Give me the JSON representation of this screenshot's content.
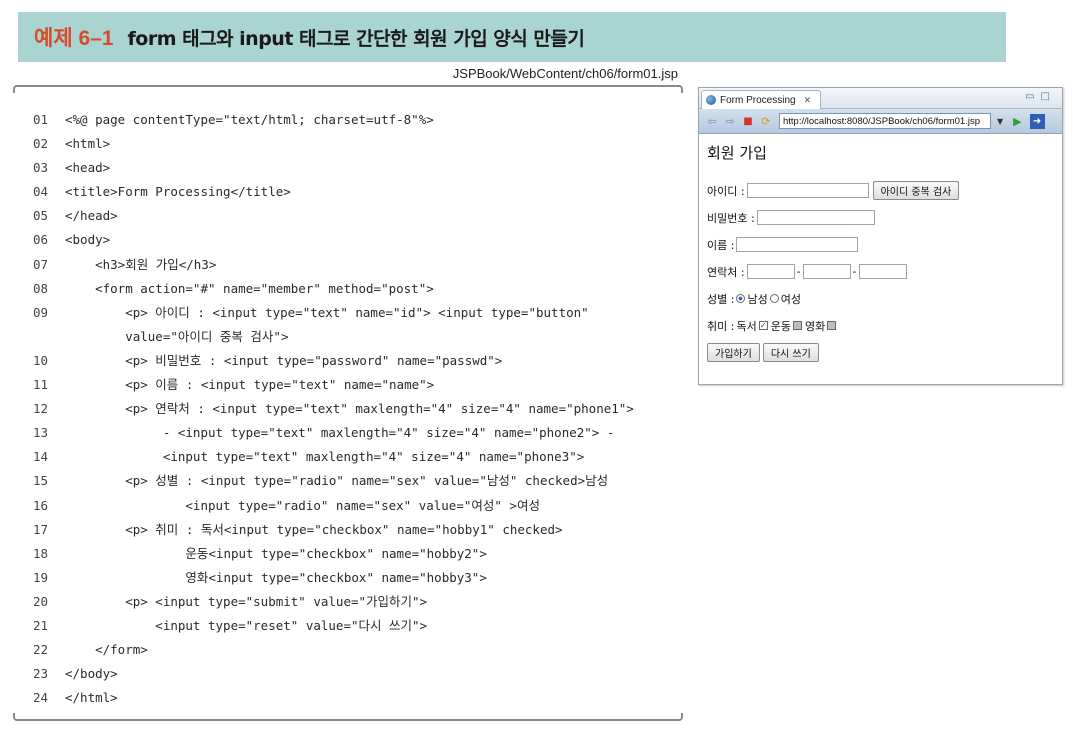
{
  "banner": {
    "example_number": "예제 6–1",
    "title": "form 태그와 input 태그로 간단한 회원 가입 양식 만들기"
  },
  "file_path": "JSPBook/WebContent/ch06/form01.jsp",
  "code_lines": [
    {
      "n": "01",
      "text": "<%@ page contentType=\"text/html; charset=utf-8\"%>"
    },
    {
      "n": "02",
      "text": "<html>"
    },
    {
      "n": "03",
      "text": "<head>"
    },
    {
      "n": "04",
      "text": "<title>Form Processing</title>"
    },
    {
      "n": "05",
      "text": "</head>"
    },
    {
      "n": "06",
      "text": "<body>"
    },
    {
      "n": "07",
      "text": "    <h3>회원 가입</h3>"
    },
    {
      "n": "08",
      "text": "    <form action=\"#\" name=\"member\" method=\"post\">"
    },
    {
      "n": "09",
      "text": "        <p> 아이디 : <input type=\"text\" name=\"id\"> <input type=\"button\""
    },
    {
      "n": "",
      "text": "        value=\"아이디 중복 검사\">"
    },
    {
      "n": "10",
      "text": "        <p> 비밀번호 : <input type=\"password\" name=\"passwd\">"
    },
    {
      "n": "11",
      "text": "        <p> 이름 : <input type=\"text\" name=\"name\">"
    },
    {
      "n": "12",
      "text": "        <p> 연락처 : <input type=\"text\" maxlength=\"4\" size=\"4\" name=\"phone1\">"
    },
    {
      "n": "13",
      "text": "             - <input type=\"text\" maxlength=\"4\" size=\"4\" name=\"phone2\"> -"
    },
    {
      "n": "14",
      "text": "             <input type=\"text\" maxlength=\"4\" size=\"4\" name=\"phone3\">"
    },
    {
      "n": "15",
      "text": "        <p> 성별 : <input type=\"radio\" name=\"sex\" value=\"남성\" checked>남성"
    },
    {
      "n": "16",
      "text": "                <input type=\"radio\" name=\"sex\" value=\"여성\" >여성"
    },
    {
      "n": "17",
      "text": "        <p> 취미 : 독서<input type=\"checkbox\" name=\"hobby1\" checked>"
    },
    {
      "n": "18",
      "text": "                운동<input type=\"checkbox\" name=\"hobby2\">"
    },
    {
      "n": "19",
      "text": "                영화<input type=\"checkbox\" name=\"hobby3\">"
    },
    {
      "n": "20",
      "text": "        <p> <input type=\"submit\" value=\"가입하기\">"
    },
    {
      "n": "21",
      "text": "            <input type=\"reset\" value=\"다시 쓰기\">"
    },
    {
      "n": "22",
      "text": "    </form>"
    },
    {
      "n": "23",
      "text": "</body>"
    },
    {
      "n": "24",
      "text": "</html>"
    }
  ],
  "browser": {
    "tab_title": "Form Processing",
    "tab_close": "✕",
    "url": "http://localhost:8080/JSPBook/ch06/form01.jsp",
    "page": {
      "heading": "회원 가입",
      "id_label": "아이디 :",
      "id_check_button": "아이디 중복 검사",
      "password_label": "비밀번호 :",
      "name_label": "이름 :",
      "phone_label": "연락처 :",
      "phone_sep": "-",
      "gender_label": "성별 :",
      "gender_male": "남성",
      "gender_female": "여성",
      "gender_selected": "남성",
      "hobby_label": "취미 :",
      "hobby_reading": "독서",
      "hobby_exercise": "운동",
      "hobby_movie": "영화",
      "hobby_checked": [
        "독서"
      ],
      "submit_button": "가입하기",
      "reset_button": "다시 쓰기"
    }
  },
  "colors": {
    "banner_bg": "#a9d4d2",
    "example_number": "#d64b2a"
  }
}
